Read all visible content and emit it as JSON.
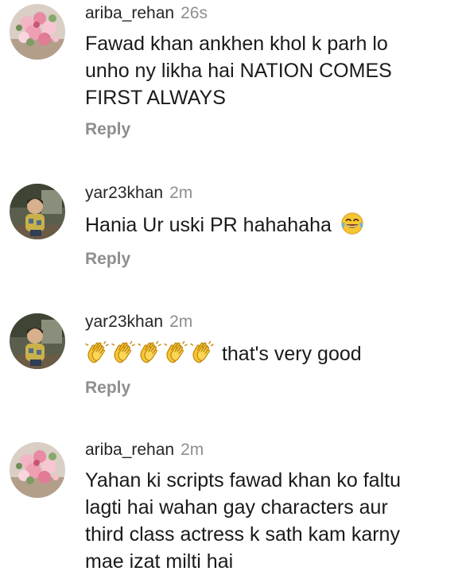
{
  "comments": [
    {
      "username": "ariba_rehan",
      "time": "26s",
      "text_lines": [
        "Fawad khan ankhen khol k parh lo",
        "unho ny likha hai NATION COMES",
        "FIRST ALWAYS"
      ],
      "reply_label": "Reply",
      "avatar_icon": "flower-bouquet-avatar"
    },
    {
      "username": "yar23khan",
      "time": "2m",
      "text": "Hania Ur uski PR hahahaha",
      "emoji": "face-with-tears-of-joy-icon",
      "reply_label": "Reply",
      "avatar_icon": "child-photo-avatar"
    },
    {
      "username": "yar23khan",
      "time": "2m",
      "emojis": [
        "clapping-hands-icon",
        "clapping-hands-icon",
        "clapping-hands-icon",
        "clapping-hands-icon",
        "clapping-hands-icon"
      ],
      "text": "that's very good",
      "reply_label": "Reply",
      "avatar_icon": "child-photo-avatar"
    },
    {
      "username": "ariba_rehan",
      "time": "2m",
      "text_lines": [
        "Yahan ki scripts fawad khan ko faltu",
        "lagti hai wahan gay characters aur",
        "third class actress k sath kam karny",
        "mae izat milti hai"
      ],
      "avatar_icon": "flower-bouquet-avatar"
    }
  ],
  "colors": {
    "username": "#262626",
    "timestamp": "#8e8e8e",
    "reply": "#8e8e8e",
    "text": "#1a1a1a",
    "emoji_yellow": "#f7c634"
  }
}
